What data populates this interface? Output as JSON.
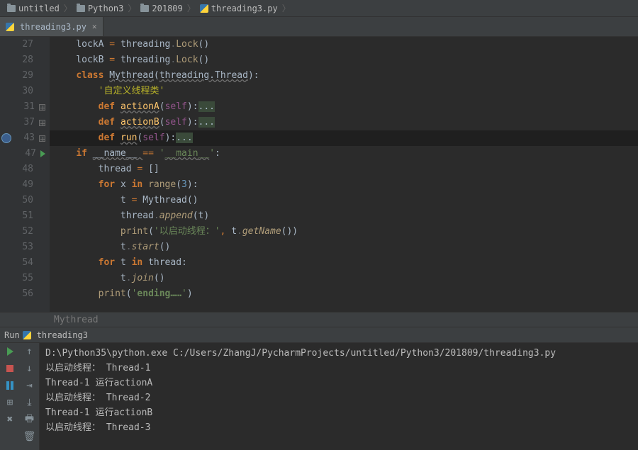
{
  "breadcrumb": [
    {
      "label": "untitled",
      "type": "folder"
    },
    {
      "label": "Python3",
      "type": "folder"
    },
    {
      "label": "201809",
      "type": "folder"
    },
    {
      "label": "threading3.py",
      "type": "python"
    }
  ],
  "tab": {
    "label": "threading3.py"
  },
  "code": {
    "lines": [
      {
        "num": "27",
        "fold": "",
        "tokens": [
          [
            "    lockA ",
            ""
          ],
          [
            "= ",
            "kw2"
          ],
          [
            "threading",
            ""
          ],
          [
            ".",
            "gray"
          ],
          [
            "Lock",
            "call"
          ],
          [
            "()",
            ""
          ]
        ]
      },
      {
        "num": "28",
        "fold": "",
        "tokens": [
          [
            "    lockB ",
            ""
          ],
          [
            "= ",
            "kw2"
          ],
          [
            "threading",
            ""
          ],
          [
            ".",
            "gray"
          ],
          [
            "Lock",
            "call"
          ],
          [
            "()",
            ""
          ]
        ]
      },
      {
        "num": "29",
        "fold": "",
        "tokens": [
          [
            "    ",
            ""
          ],
          [
            "class ",
            "kw"
          ],
          [
            "Mythread",
            "cname"
          ],
          [
            "(",
            ""
          ],
          [
            "threading.Thread",
            "wavy"
          ],
          [
            "):",
            ""
          ]
        ]
      },
      {
        "num": "30",
        "fold": "",
        "tokens": [
          [
            "        ",
            ""
          ],
          [
            "'自定义线程类'",
            "doc"
          ]
        ]
      },
      {
        "num": "31",
        "fold": "plus",
        "tokens": [
          [
            "        ",
            ""
          ],
          [
            "def ",
            "kw"
          ],
          [
            "actionA",
            "fname"
          ],
          [
            "(",
            ""
          ],
          [
            "self",
            "self"
          ],
          [
            "):",
            ""
          ],
          [
            "...",
            "fold-bg"
          ]
        ]
      },
      {
        "num": "37",
        "fold": "plus",
        "tokens": [
          [
            "        ",
            ""
          ],
          [
            "def ",
            "kw"
          ],
          [
            "actionB",
            "fname"
          ],
          [
            "(",
            ""
          ],
          [
            "self",
            "self"
          ],
          [
            "):",
            ""
          ],
          [
            "...",
            "fold-bg"
          ]
        ]
      },
      {
        "num": "43",
        "fold": "plus",
        "hi": "dark",
        "badge": true,
        "tokens": [
          [
            "        ",
            ""
          ],
          [
            "def ",
            "kw"
          ],
          [
            "run",
            "fname"
          ],
          [
            "(",
            ""
          ],
          [
            "self",
            "self"
          ],
          [
            "):",
            ""
          ],
          [
            "...",
            "fold-bg"
          ]
        ]
      },
      {
        "num": "47",
        "fold": "run",
        "tokens": [
          [
            "    ",
            ""
          ],
          [
            "if ",
            "kw"
          ],
          [
            "__",
            "wavy"
          ],
          [
            "name",
            "wavy"
          ],
          [
            "__ ",
            "wavy"
          ],
          [
            "== ",
            "kw2"
          ],
          [
            "'",
            "str"
          ],
          [
            "__",
            "str wavy"
          ],
          [
            "main",
            "str wavy"
          ],
          [
            "__",
            "str wavy"
          ],
          [
            "'",
            "str"
          ],
          [
            ":",
            ""
          ]
        ]
      },
      {
        "num": "48",
        "fold": "",
        "tokens": [
          [
            "        thread ",
            ""
          ],
          [
            "= ",
            "kw2"
          ],
          [
            "[]",
            ""
          ]
        ]
      },
      {
        "num": "49",
        "fold": "",
        "tokens": [
          [
            "        ",
            ""
          ],
          [
            "for ",
            "kw"
          ],
          [
            "x ",
            ""
          ],
          [
            "in ",
            "kw"
          ],
          [
            "range",
            "call"
          ],
          [
            "(",
            ""
          ],
          [
            "3",
            "num"
          ],
          [
            "):",
            ""
          ]
        ]
      },
      {
        "num": "50",
        "fold": "",
        "tokens": [
          [
            "            t ",
            ""
          ],
          [
            "= ",
            "kw2"
          ],
          [
            "Mythread()",
            ""
          ]
        ]
      },
      {
        "num": "51",
        "fold": "",
        "tokens": [
          [
            "            thread",
            ""
          ],
          [
            ".",
            "gray"
          ],
          [
            "append",
            "callit"
          ],
          [
            "(t)",
            ""
          ]
        ]
      },
      {
        "num": "52",
        "fold": "",
        "tokens": [
          [
            "            ",
            ""
          ],
          [
            "print",
            "call"
          ],
          [
            "(",
            ""
          ],
          [
            "'以启动线程：'",
            "str"
          ],
          [
            ", ",
            "kw2"
          ],
          [
            "t",
            ""
          ],
          [
            ".",
            "gray"
          ],
          [
            "getName",
            "callit"
          ],
          [
            "())",
            ""
          ]
        ]
      },
      {
        "num": "53",
        "fold": "",
        "tokens": [
          [
            "            t",
            ""
          ],
          [
            ".",
            "gray"
          ],
          [
            "start",
            "callit"
          ],
          [
            "()",
            ""
          ]
        ]
      },
      {
        "num": "54",
        "fold": "",
        "tokens": [
          [
            "        ",
            ""
          ],
          [
            "for ",
            "kw"
          ],
          [
            "t ",
            ""
          ],
          [
            "in ",
            "kw"
          ],
          [
            "thread",
            ""
          ],
          [
            ":",
            ""
          ]
        ]
      },
      {
        "num": "55",
        "fold": "",
        "tokens": [
          [
            "            t",
            ""
          ],
          [
            ".",
            "gray"
          ],
          [
            "join",
            "callit"
          ],
          [
            "()",
            ""
          ]
        ]
      },
      {
        "num": "56",
        "fold": "",
        "tokens": [
          [
            "        ",
            ""
          ],
          [
            "print",
            "call"
          ],
          [
            "(",
            ""
          ],
          [
            "'",
            "str"
          ],
          [
            "ending……",
            "str-bold"
          ],
          [
            "'",
            "str"
          ],
          [
            ")",
            ""
          ]
        ]
      }
    ]
  },
  "context": "Mythread",
  "run": {
    "header_label": "Run",
    "header_target": "threading3",
    "lines": [
      "D:\\Python35\\python.exe C:/Users/ZhangJ/PycharmProjects/untitled/Python3/201809/threading3.py",
      "以启动线程： Thread-1",
      "Thread-1 运行actionA",
      "以启动线程： Thread-2",
      "Thread-1 运行actionB",
      "以启动线程： Thread-3"
    ]
  }
}
